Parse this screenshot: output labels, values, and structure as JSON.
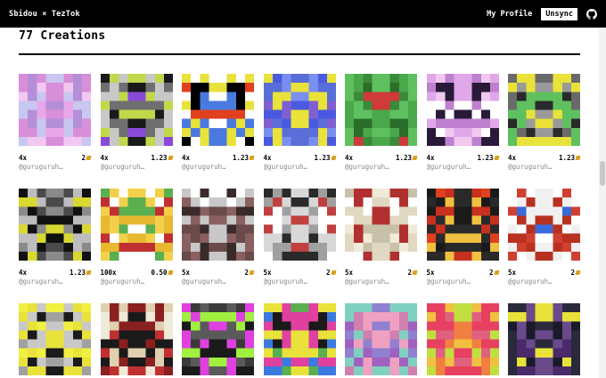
{
  "header": {
    "brand": "Sbidou × TezTok",
    "my_profile": "My Profile",
    "unsync": "Unsync",
    "github_icon": "github-icon"
  },
  "section": {
    "title": "77 Creations"
  },
  "creations": [
    {
      "editions": "4x",
      "price": "2",
      "creator": "@guruguruh…",
      "palette": [
        "#e9a6e9",
        "#d98ed9",
        "#f2c8f2",
        "#c7c7f0",
        "#b48fd8"
      ]
    },
    {
      "editions": "4x",
      "price": "1.23",
      "creator": "@guruguruh…",
      "palette": [
        "#1a1a1a",
        "#6f6f6f",
        "#c8c8c8",
        "#c0d84a",
        "#8a4ad8"
      ]
    },
    {
      "editions": "4x",
      "price": "1.23",
      "creator": "@guruguruh…",
      "palette": [
        "#000000",
        "#e0401e",
        "#ffffff",
        "#4a7ae0",
        "#e8e23a"
      ]
    },
    {
      "editions": "4x",
      "price": "1.23",
      "creator": "@guruguruh…",
      "palette": [
        "#7a8ef0",
        "#4a5ae0",
        "#5a6ed8",
        "#e8e23a",
        "#8060d0"
      ]
    },
    {
      "editions": "4x",
      "price": "1.23",
      "creator": "@guruguruh…",
      "palette": [
        "#4aa84a",
        "#3a8a3a",
        "#5fc060",
        "#d03a3a",
        "#2a6e2a"
      ]
    },
    {
      "editions": "4x",
      "price": "1.23",
      "creator": "@guruguruh…",
      "palette": [
        "#ffffff",
        "#e0a8e8",
        "#c080d0",
        "#2a1a3a",
        "#f0c8f0"
      ]
    },
    {
      "editions": "4x",
      "price": "1.23",
      "creator": "@guruguruh…",
      "palette": [
        "#9a9a9a",
        "#6a6a6a",
        "#2a2a2a",
        "#e8e23a",
        "#5fc060"
      ]
    },
    {
      "editions": "4x",
      "price": "1.23",
      "creator": "@guruguruh…",
      "palette": [
        "#111111",
        "#8a8a8a",
        "#bdbdbd",
        "#d8d830",
        "#4a4a4a"
      ]
    },
    {
      "editions": "100x",
      "price": "0.50",
      "creator": "@guruguruh…",
      "palette": [
        "#ffffff",
        "#f2d04a",
        "#e8b830",
        "#c03030",
        "#5ab050"
      ]
    },
    {
      "editions": "5x",
      "price": "2",
      "creator": "@guruguruh…",
      "palette": [
        "#ffffff",
        "#3a2a2a",
        "#6a4a4a",
        "#c8c8c8",
        "#8a6060"
      ]
    },
    {
      "editions": "5x",
      "price": "2",
      "creator": "@guruguruh…",
      "palette": [
        "#d8d8d8",
        "#c04040",
        "#2a2a2a",
        "#ffffff",
        "#a0a0a0"
      ]
    },
    {
      "editions": "5x",
      "price": "2",
      "creator": "@guruguruh…",
      "palette": [
        "#f0ead8",
        "#e0d8c0",
        "#c8c0a8",
        "#b03030",
        "#ffffff"
      ]
    },
    {
      "editions": "5x",
      "price": "2",
      "creator": "@guruguruh…",
      "palette": [
        "#2a2a2a",
        "#1a1a1a",
        "#e0401e",
        "#f0c040",
        "#c83020"
      ]
    },
    {
      "editions": "5x",
      "price": "2",
      "creator": "@guruguruh…",
      "palette": [
        "#ffffff",
        "#d04030",
        "#3a6ad8",
        "#b83020",
        "#f0f0f0"
      ]
    },
    {
      "editions": "",
      "price": "",
      "creator": "",
      "palette": [
        "#e8e23a",
        "#c8c8c8",
        "#1a1a1a",
        "#a0a0a0",
        "#f0f040"
      ]
    },
    {
      "editions": "",
      "price": "",
      "creator": "",
      "palette": [
        "#c03030",
        "#f0ead8",
        "#1a1a1a",
        "#e0d0b0",
        "#8a2020"
      ]
    },
    {
      "editions": "",
      "price": "",
      "creator": "",
      "palette": [
        "#1a1a1a",
        "#a0f040",
        "#e040e0",
        "#3a3a3a",
        "#5a5a5a"
      ]
    },
    {
      "editions": "",
      "price": "",
      "creator": "",
      "palette": [
        "#e040a0",
        "#3a7ae0",
        "#e8e23a",
        "#5ab050",
        "#1a1a1a"
      ]
    },
    {
      "editions": "",
      "price": "",
      "creator": "",
      "palette": [
        "#a060c0",
        "#80d0c0",
        "#d080b0",
        "#9080d0",
        "#f0a0c0"
      ]
    },
    {
      "editions": "",
      "price": "",
      "creator": "",
      "palette": [
        "#e84060",
        "#f08040",
        "#f0c040",
        "#c0e040",
        "#e06080"
      ]
    },
    {
      "editions": "",
      "price": "",
      "creator": "",
      "palette": [
        "#1a1a2a",
        "#4a2a6a",
        "#e8e23a",
        "#6a4a8a",
        "#2a2a3a"
      ]
    }
  ]
}
